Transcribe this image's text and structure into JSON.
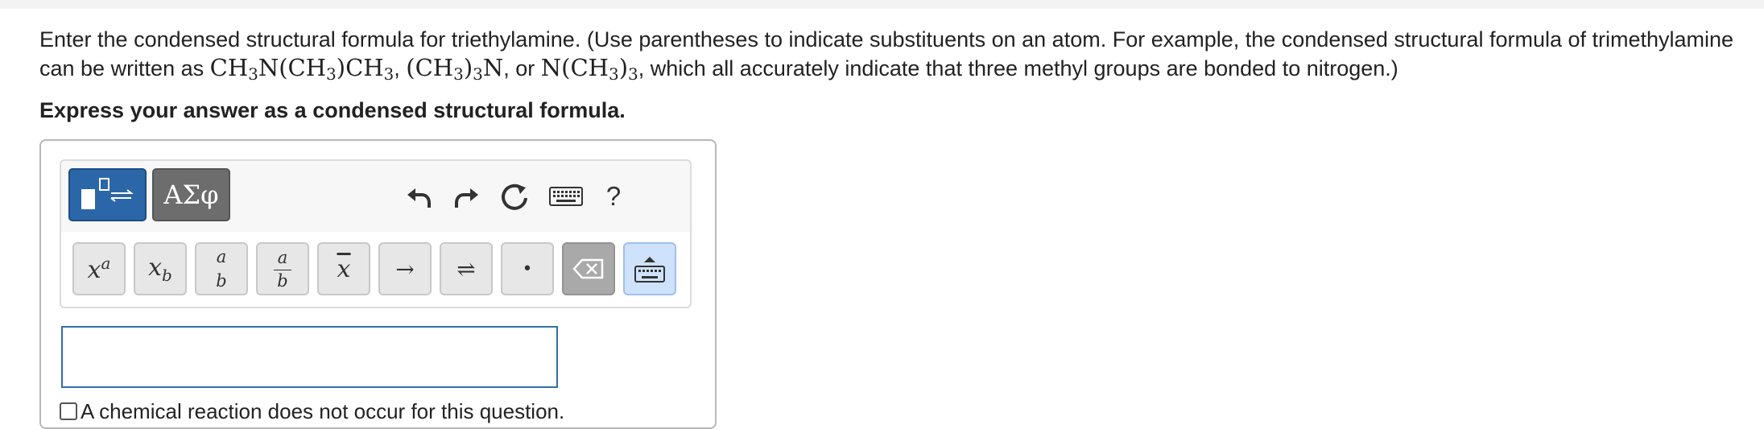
{
  "question": {
    "text_1": "Enter the condensed structural formula for triethylamine. (Use parentheses to indicate substituents on an atom. For example, the condensed structural formula of trimethylamine can be written as ",
    "text_2": ", ",
    "text_3": ", or ",
    "text_4": ", which all accurately indicate that three methyl groups are bonded to nitrogen.)",
    "example_formulas": [
      "CH3N(CH3)CH3",
      "(CH3)3N",
      "N(CH3)3"
    ]
  },
  "instruction": "Express your answer as a condensed structural formula.",
  "toolbar": {
    "templates_icon": "templates-icon",
    "greek_label": "ΑΣφ",
    "help_label": "?",
    "top_icons": [
      "undo-icon",
      "redo-icon",
      "reset-icon",
      "keyboard-icon",
      "help-icon"
    ],
    "keys": [
      {
        "name": "superscript",
        "icon": "superscript-icon"
      },
      {
        "name": "subscript",
        "icon": "subscript-icon"
      },
      {
        "name": "fraction",
        "icon": "fraction-icon"
      },
      {
        "name": "fraction-bar",
        "icon": "fraction-bar-icon"
      },
      {
        "name": "overline",
        "icon": "overline-icon"
      },
      {
        "name": "reaction-arrow",
        "icon": "arrow-right-icon"
      },
      {
        "name": "equilibrium-arrow",
        "icon": "equilibrium-icon"
      },
      {
        "name": "dot",
        "icon": "dot-icon"
      },
      {
        "name": "backspace",
        "icon": "backspace-icon"
      },
      {
        "name": "toggle-keyboard",
        "icon": "keyboard-toggle-icon"
      }
    ],
    "superscript_base": "x",
    "superscript_exp": "a",
    "subscript_base": "x",
    "subscript_sub": "b",
    "fraction_num": "a",
    "fraction_den": "b",
    "overline_char": "x",
    "arrow_char": "→",
    "equilibrium_char": "⇌",
    "dot_char": "•"
  },
  "answer_input": {
    "value": ""
  },
  "no_reaction_label": "A chemical reaction does not occur for this question.",
  "colors": {
    "accent": "#2b67a8",
    "input_border": "#2f70a8",
    "greek_button": "#6d6d6d",
    "backspace_key": "#a9a9a9",
    "keyboard_toggle": "#cfe2fb"
  }
}
